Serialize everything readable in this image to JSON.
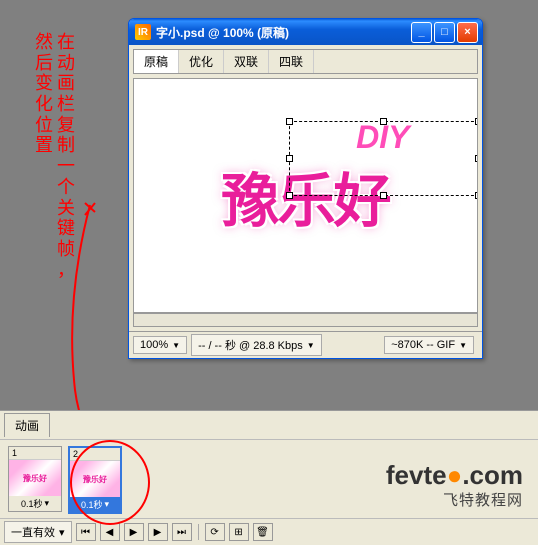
{
  "annotation": {
    "col1": "然后变化位置",
    "col2": "在动画栏复制一个关键帧，"
  },
  "window": {
    "title": "字小.psd @ 100% (原稿)",
    "tabs": [
      "原稿",
      "优化",
      "双联",
      "四联"
    ],
    "active_tab": 0,
    "artwork_main": "豫乐好",
    "artwork_diy": "DIY",
    "status": {
      "zoom": "100%",
      "timing": "-- / -- 秒 @ 28.8 Kbps",
      "size": "~870K -- GIF"
    }
  },
  "animation": {
    "tab_label": "动画",
    "frames": [
      {
        "num": "1",
        "delay": "0.1秒",
        "selected": false
      },
      {
        "num": "2",
        "delay": "0.1秒",
        "selected": true
      }
    ],
    "loop": "一直有效"
  },
  "watermark": {
    "url_a": "fevte",
    "url_b": ".com",
    "sub": "飞特教程网"
  }
}
